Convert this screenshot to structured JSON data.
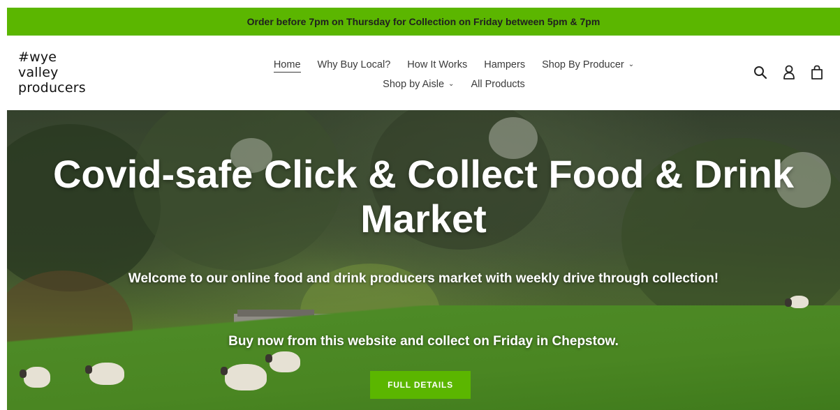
{
  "announcement": "Order before 7pm on Thursday for Collection on Friday between 5pm & 7pm",
  "logo": {
    "lines": [
      "#wye",
      "valley",
      "producers"
    ]
  },
  "nav": {
    "row1": [
      {
        "label": "Home",
        "active": true
      },
      {
        "label": "Why Buy Local?"
      },
      {
        "label": "How It Works"
      },
      {
        "label": "Hampers"
      },
      {
        "label": "Shop By Producer",
        "dropdown": true
      }
    ],
    "row2": [
      {
        "label": "Shop by Aisle",
        "dropdown": true
      },
      {
        "label": "All Products"
      }
    ]
  },
  "header_icons": [
    "search-icon",
    "account-icon",
    "cart-icon"
  ],
  "hero": {
    "title": "Covid-safe Click & Collect Food & Drink Market",
    "subtitle": "Welcome to our online food and drink producers market with weekly drive through collection!",
    "subtitle2": "Buy now from this website and collect on Friday in Chepstow.",
    "cta_label": "FULL DETAILS"
  },
  "colors": {
    "accent": "#5bb600",
    "text": "#3a3a3a"
  }
}
